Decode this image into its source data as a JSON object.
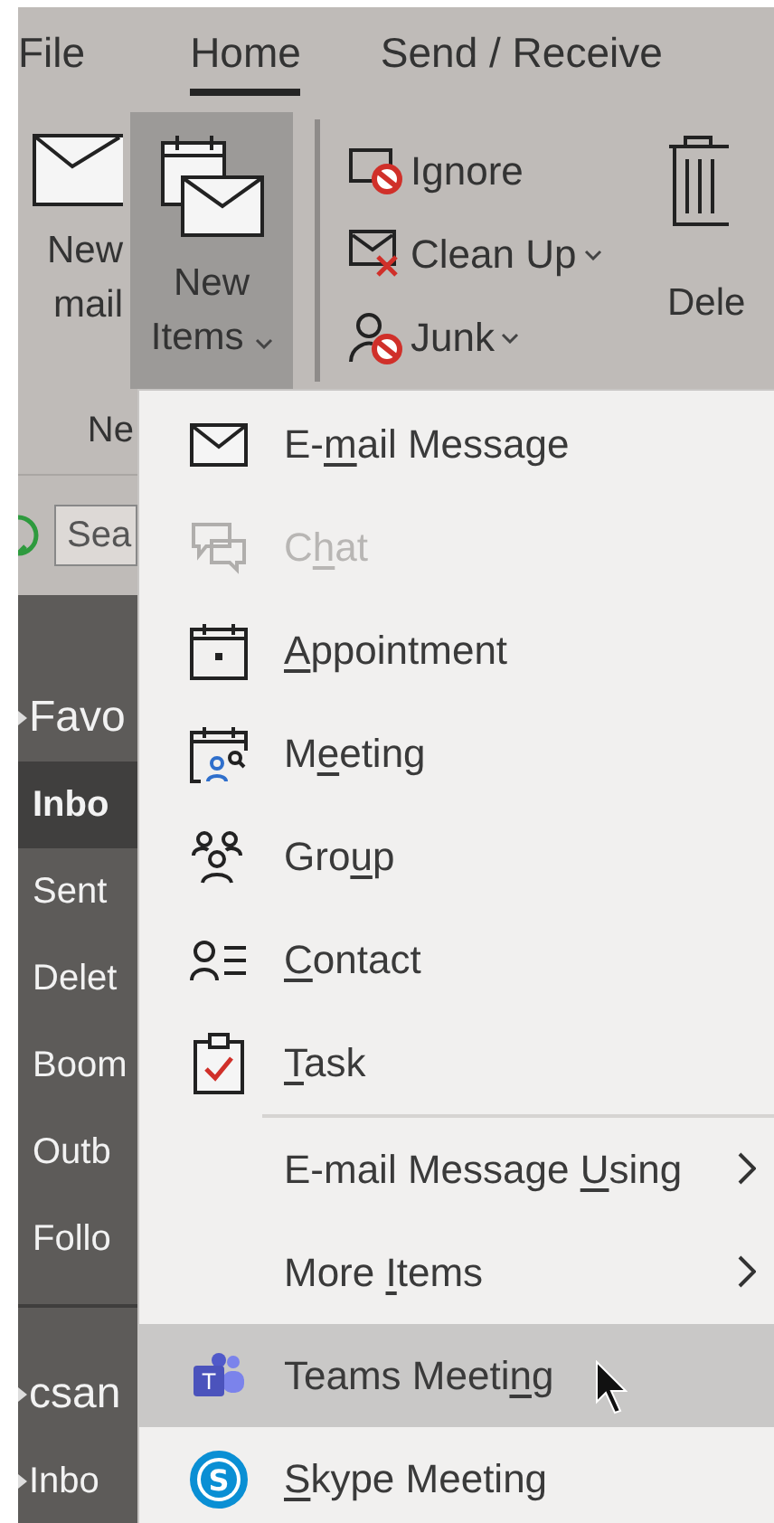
{
  "tabs": [
    {
      "label": "File",
      "selected": false
    },
    {
      "label": "Home",
      "selected": true
    },
    {
      "label": "Send / Receive",
      "selected": false
    }
  ],
  "ribbon": {
    "large_buttons": [
      {
        "lines": [
          "New",
          "mail"
        ],
        "pressed": false,
        "caret": false
      },
      {
        "lines": [
          "New",
          "Items"
        ],
        "pressed": true,
        "caret": true
      }
    ],
    "small_buttons": [
      {
        "label": "Ignore",
        "caret": false
      },
      {
        "label": "Clean Up",
        "caret": true
      },
      {
        "label": "Junk",
        "caret": true
      }
    ],
    "delete_button": {
      "label": "Dele"
    },
    "group_label": "Ne"
  },
  "search": {
    "placeholder": "Sea"
  },
  "sidebar": {
    "items": [
      {
        "kind": "header",
        "label": "Favo",
        "selected": false
      },
      {
        "kind": "folder",
        "label": "Inbo",
        "selected": true
      },
      {
        "kind": "folder",
        "label": "Sent",
        "selected": false
      },
      {
        "kind": "folder",
        "label": "Delet",
        "selected": false
      },
      {
        "kind": "folder",
        "label": "Boom",
        "selected": false
      },
      {
        "kind": "folder",
        "label": "Outb",
        "selected": false
      },
      {
        "kind": "folder",
        "label": "Follo",
        "selected": false
      },
      {
        "kind": "header",
        "label": "csan",
        "selected": false
      },
      {
        "kind": "subfolder",
        "label": "Inbo",
        "selected": false
      }
    ]
  },
  "menu": {
    "items": [
      {
        "kind": "item",
        "before": "E-",
        "key": "m",
        "after": "ail Message",
        "disabled": false,
        "selected": false
      },
      {
        "kind": "item",
        "before": "C",
        "key": "h",
        "after": "at",
        "disabled": true,
        "selected": false
      },
      {
        "kind": "item",
        "key": "A",
        "after": "ppointment",
        "disabled": false,
        "selected": false
      },
      {
        "kind": "item",
        "before": "M",
        "key": "e",
        "after": "eting",
        "disabled": false,
        "selected": false
      },
      {
        "kind": "item",
        "before": "Gro",
        "key": "u",
        "after": "p",
        "disabled": false,
        "selected": false
      },
      {
        "kind": "item",
        "key": "C",
        "after": "ontact",
        "disabled": false,
        "selected": false
      },
      {
        "kind": "item",
        "key": "T",
        "after": "ask",
        "disabled": false,
        "selected": false
      },
      {
        "kind": "separator"
      },
      {
        "kind": "submenu",
        "before": "E-mail Message ",
        "key": "U",
        "after": "sing",
        "disabled": false,
        "selected": false
      },
      {
        "kind": "submenu",
        "before": "More ",
        "key": "I",
        "after": "tems",
        "disabled": false,
        "selected": false
      },
      {
        "kind": "item",
        "before": "Teams Meeti",
        "key": "n",
        "after": "g",
        "disabled": false,
        "selected": true,
        "logo_text": "T"
      },
      {
        "kind": "item",
        "key": "S",
        "after": "kype Meeting",
        "disabled": false,
        "selected": false,
        "logo_text": "S"
      }
    ]
  }
}
